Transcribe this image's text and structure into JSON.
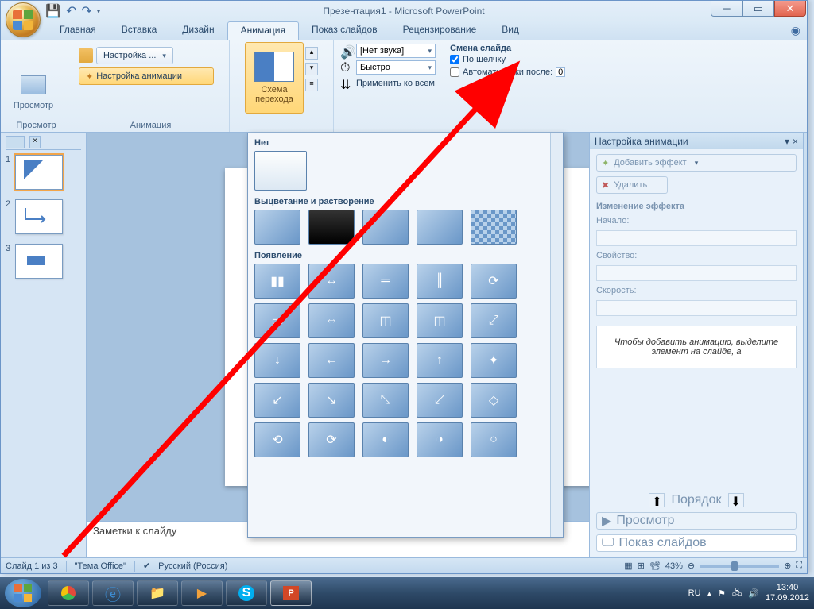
{
  "title": "Презентация1 - Microsoft PowerPoint",
  "tabs": {
    "home": "Главная",
    "insert": "Вставка",
    "design": "Дизайн",
    "animation": "Анимация",
    "slideshow": "Показ слайдов",
    "review": "Рецензирование",
    "view": "Вид"
  },
  "ribbon": {
    "preview_group": "Просмотр",
    "preview_btn": "Просмотр",
    "anim_group": "Анимация",
    "custom_btn": "Настройка ...",
    "anim_settings": "Настройка анимации",
    "scheme": "Схема перехода",
    "scheme_arrow": "▾",
    "sound_label": "[Нет звука]",
    "speed_label": "Быстро",
    "apply_all": "Применить ко всем",
    "change_slide": "Смена слайда",
    "on_click": "По щелчку",
    "auto_after": "Автоматически после:",
    "auto_time": "00:00"
  },
  "gallery": {
    "none": "Нет",
    "fade": "Выцветание и растворение",
    "appear": "Появление"
  },
  "thumbs": {
    "n1": "1",
    "n2": "2",
    "n3": "3"
  },
  "notes": "Заметки к слайду",
  "anim_pane": {
    "title": "Настройка анимации",
    "add": "Добавить эффект",
    "remove": "Удалить",
    "change": "Изменение эффекта",
    "start": "Начало:",
    "prop": "Свойство:",
    "speed": "Скорость:",
    "hint": "Чтобы добавить анимацию, выделите элемент на слайде, а",
    "order": "Порядок",
    "preview": "Просмотр",
    "show": "Показ слайдов"
  },
  "status": {
    "slide": "Слайд 1 из 3",
    "theme": "\"Тема Office\"",
    "lang": "Русский (Россия)",
    "zoom": "43%"
  },
  "tray": {
    "lang": "RU",
    "time": "13:40",
    "date": "17.09.2012"
  }
}
